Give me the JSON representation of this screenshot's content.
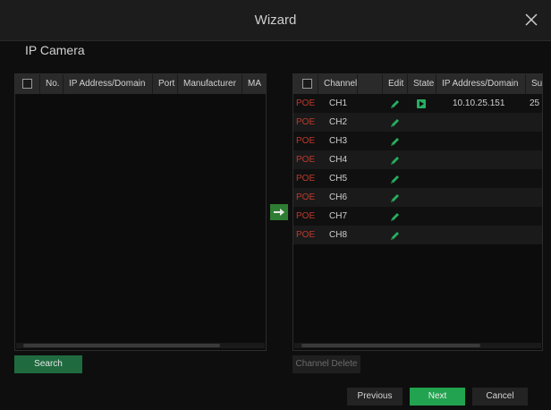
{
  "window": {
    "title": "Wizard",
    "section_title": "IP Camera"
  },
  "left_table": {
    "headers": [
      "No.",
      "IP Address/Domain",
      "Port",
      "Manufacturer",
      "MA"
    ]
  },
  "right_table": {
    "headers": [
      "Channel",
      "",
      "Edit",
      "State",
      "IP Address/Domain",
      "Sub"
    ],
    "rows": [
      {
        "type": "POE",
        "channel": "CH1",
        "ip": "10.10.25.151",
        "sub": "25",
        "has_state": true
      },
      {
        "type": "POE",
        "channel": "CH2",
        "ip": "",
        "sub": "",
        "has_state": false
      },
      {
        "type": "POE",
        "channel": "CH3",
        "ip": "",
        "sub": "",
        "has_state": false
      },
      {
        "type": "POE",
        "channel": "CH4",
        "ip": "",
        "sub": "",
        "has_state": false
      },
      {
        "type": "POE",
        "channel": "CH5",
        "ip": "",
        "sub": "",
        "has_state": false
      },
      {
        "type": "POE",
        "channel": "CH6",
        "ip": "",
        "sub": "",
        "has_state": false
      },
      {
        "type": "POE",
        "channel": "CH7",
        "ip": "",
        "sub": "",
        "has_state": false
      },
      {
        "type": "POE",
        "channel": "CH8",
        "ip": "",
        "sub": "",
        "has_state": false
      }
    ]
  },
  "buttons": {
    "search": "Search",
    "channel_delete": "Channel Delete",
    "previous": "Previous",
    "next": "Next",
    "cancel": "Cancel"
  },
  "colors": {
    "accent_green": "#2e7d32",
    "poe_red": "#c0392b",
    "edit_green": "#27ae60"
  },
  "icons": [
    "close-icon",
    "edit-icon",
    "play-state-icon",
    "arrow-right-icon",
    "checkbox-icon"
  ]
}
